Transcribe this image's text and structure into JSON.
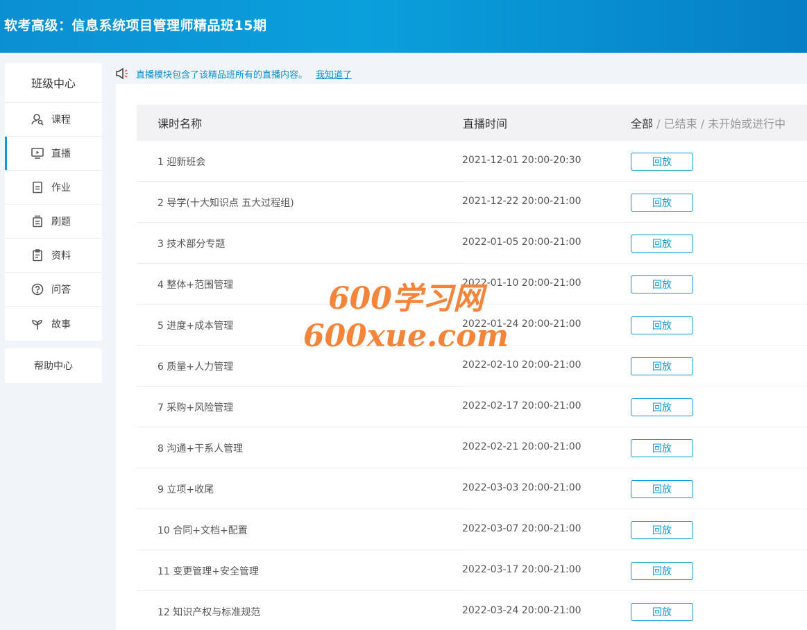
{
  "header": {
    "title": "软考高级：信息系统项目管理师精品班15期"
  },
  "sidebar": {
    "title": "班级中心",
    "items": [
      {
        "label": "课程",
        "icon": "course-icon",
        "active": false
      },
      {
        "label": "直播",
        "icon": "live-icon",
        "active": true
      },
      {
        "label": "作业",
        "icon": "homework-icon",
        "active": false
      },
      {
        "label": "刷题",
        "icon": "practice-icon",
        "active": false
      },
      {
        "label": "资料",
        "icon": "materials-icon",
        "active": false
      },
      {
        "label": "问答",
        "icon": "question-icon",
        "active": false
      },
      {
        "label": "故事",
        "icon": "story-icon",
        "active": false
      }
    ],
    "help": "帮助中心"
  },
  "notice": {
    "text": "直播模块包含了该精品班所有的直播内容。",
    "link": "我知道了",
    "icon": "megaphone-icon"
  },
  "table": {
    "headers": {
      "name": "课时名称",
      "time": "直播时间"
    },
    "filters": {
      "all": "全部",
      "sep": " / ",
      "ended": "已结束",
      "upcoming": "未开始或进行中"
    },
    "button_label": "回放",
    "rows": [
      {
        "name": "1 迎新班会",
        "time": "2021-12-01 20:00-20:30"
      },
      {
        "name": "2 导学(十大知识点 五大过程组)",
        "time": "2021-12-22 20:00-21:00"
      },
      {
        "name": "3 技术部分专题",
        "time": "2022-01-05 20:00-21:00"
      },
      {
        "name": "4 整体+范围管理",
        "time": "2022-01-10 20:00-21:00"
      },
      {
        "name": "5 进度+成本管理",
        "time": "2022-01-24 20:00-21:00"
      },
      {
        "name": "6 质量+人力管理",
        "time": "2022-02-10 20:00-21:00"
      },
      {
        "name": "7 采购+风险管理",
        "time": "2022-02-17 20:00-21:00"
      },
      {
        "name": "8 沟通+干系人管理",
        "time": "2022-02-21 20:00-21:00"
      },
      {
        "name": "9 立项+收尾",
        "time": "2022-03-03 20:00-21:00"
      },
      {
        "name": "10 合同+文档+配置",
        "time": "2022-03-07 20:00-21:00"
      },
      {
        "name": "11 变更管理+安全管理",
        "time": "2022-03-17 20:00-21:00"
      },
      {
        "name": "12 知识产权与标准规范",
        "time": "2022-03-24 20:00-21:00"
      }
    ]
  },
  "watermark": {
    "line1": "600学习网",
    "line2": "600xue.com"
  },
  "colors": {
    "accent": "#0a9ad8",
    "header": "#0a9ad8",
    "watermark": "#f4843a"
  }
}
